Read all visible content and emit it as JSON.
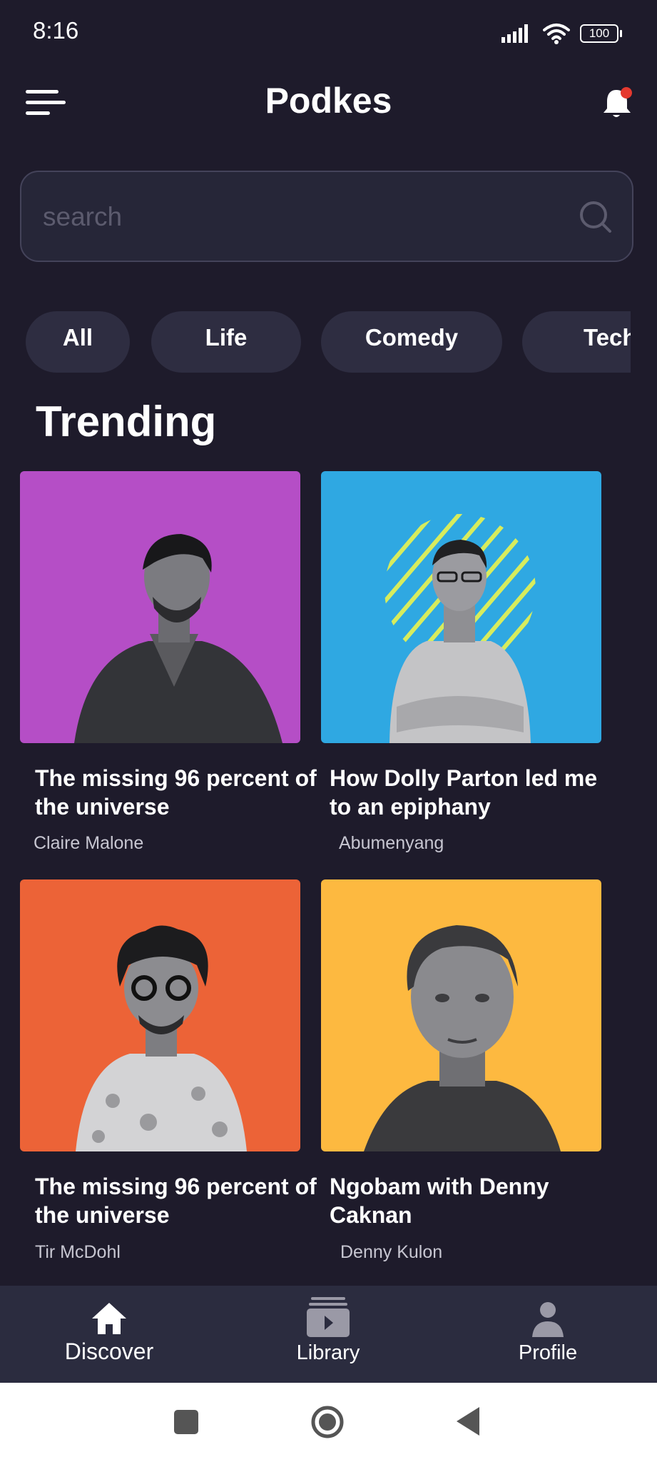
{
  "status_bar": {
    "time": "8:16",
    "battery": "100"
  },
  "header": {
    "title": "Podkes",
    "menu_icon": "menu-icon",
    "notification_icon": "bell-icon",
    "notification_dot_color": "#e5392f"
  },
  "search": {
    "placeholder": "search",
    "value": "",
    "icon": "search-icon"
  },
  "categories": [
    {
      "label": "All"
    },
    {
      "label": "Life"
    },
    {
      "label": "Comedy"
    },
    {
      "label": "Tech"
    }
  ],
  "trending": {
    "heading": "Trending",
    "cards": [
      {
        "title": "The missing 96 percent of the universe",
        "author": "Claire Malone",
        "background": "#b54ec6"
      },
      {
        "title": "How Dolly Parton led me to an epiphany",
        "author": "Abumenyang",
        "background": "#2fa8e2"
      },
      {
        "title": "The missing 96 percent of the universe",
        "author": "Tir McDohl",
        "background": "#ec6337"
      },
      {
        "title": "Ngobam with Denny Caknan",
        "author": "Denny Kulon",
        "background": "#fdb940"
      }
    ]
  },
  "bottom_nav": {
    "items": [
      {
        "label": "Discover",
        "icon": "home-icon",
        "active": true
      },
      {
        "label": "Library",
        "icon": "library-icon",
        "active": false
      },
      {
        "label": "Profile",
        "icon": "profile-icon",
        "active": false
      }
    ]
  },
  "colors": {
    "background": "#1e1b2b",
    "surface": "#2e2d41",
    "nav_background": "#2b2c3f",
    "active": "#ffffff",
    "inactive": "#9a99a6"
  }
}
